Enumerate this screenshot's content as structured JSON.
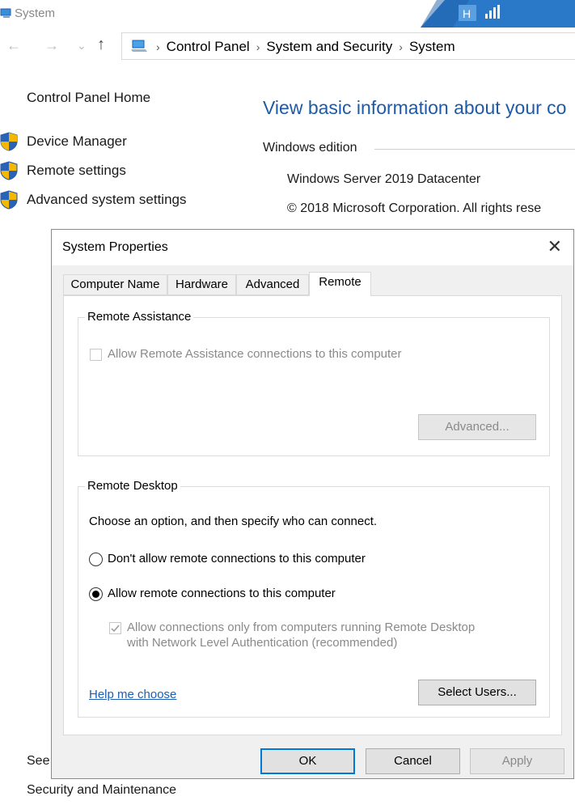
{
  "window": {
    "title": "System"
  },
  "address_bar": {
    "crumbs": [
      "Control Panel",
      "System and Security",
      "System"
    ],
    "sep1": "›",
    "sep2": "›",
    "sep3": "›"
  },
  "nav": {
    "back": "←",
    "forward": "→",
    "dropdown": "⌄",
    "up": "↑"
  },
  "left_pane": {
    "home": "Control Panel Home",
    "links": [
      "Device Manager",
      "Remote settings",
      "Advanced system settings"
    ],
    "see_also": "See",
    "security": "Security and Maintenance"
  },
  "main": {
    "title": "View basic information about your co",
    "section": "Windows edition",
    "edition": "Windows Server 2019 Datacenter",
    "copyright": "© 2018 Microsoft Corporation. All rights rese"
  },
  "dialog": {
    "title": "System Properties",
    "close": "✕",
    "tabs": [
      "Computer Name",
      "Hardware",
      "Advanced",
      "Remote"
    ],
    "active_tab": "Remote",
    "remote_assistance": {
      "label": "Remote Assistance",
      "checkbox": "Allow Remote Assistance connections to this computer",
      "checked": false,
      "advanced_button": "Advanced..."
    },
    "remote_desktop": {
      "label": "Remote Desktop",
      "instruction": "Choose an option, and then specify who can connect.",
      "option_deny": "Don't allow remote connections to this computer",
      "option_allow": "Allow remote connections to this computer",
      "selected": "allow",
      "nla_line1": "Allow connections only from computers running Remote Desktop",
      "nla_line2": "with Network Level Authentication (recommended)",
      "nla_checked": true,
      "help_link": "Help me choose",
      "select_users_button": "Select Users..."
    },
    "buttons": {
      "ok": "OK",
      "cancel": "Cancel",
      "apply": "Apply"
    }
  },
  "colors": {
    "accent": "#0078d7",
    "link": "#1b5fb4",
    "title_blue": "#1e5aa8"
  }
}
